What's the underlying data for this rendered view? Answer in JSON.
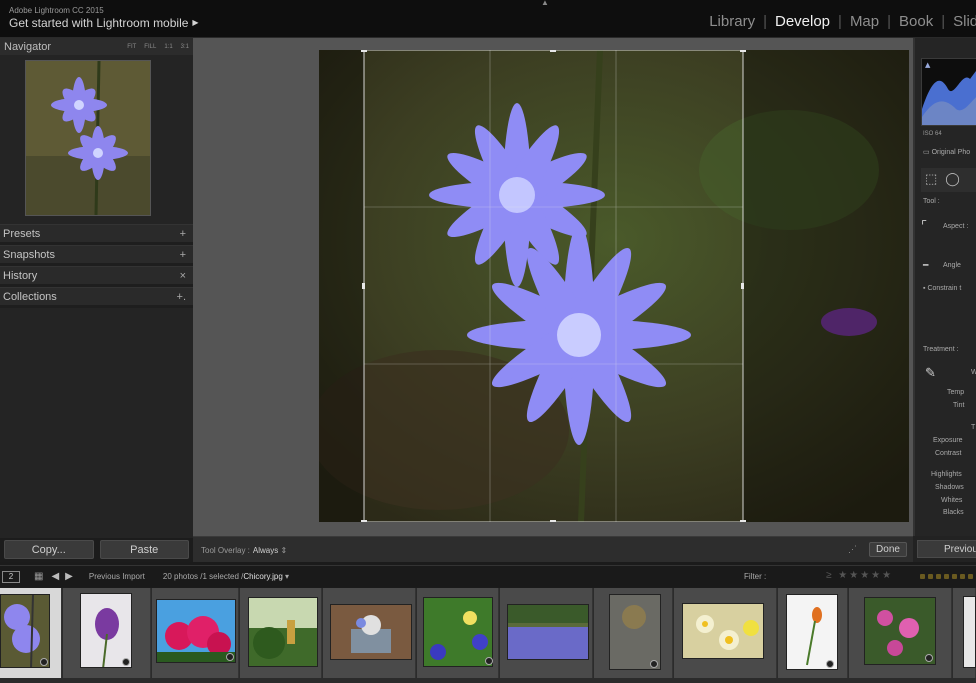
{
  "app": {
    "name": "Adobe Lightroom CC 2015",
    "promo": "Get started with Lightroom mobile",
    "modules": [
      "Library",
      "Develop",
      "Map",
      "Book",
      "Slides"
    ],
    "active_module": "Develop"
  },
  "navigator": {
    "title": "Navigator",
    "zoom_options": [
      "FIT",
      "FILL",
      "1:1",
      "3:1"
    ]
  },
  "left_panels": [
    {
      "label": "Presets",
      "symbol": "+"
    },
    {
      "label": "Snapshots",
      "symbol": "+"
    },
    {
      "label": "History",
      "symbol": "×"
    },
    {
      "label": "Collections",
      "symbol": "+."
    }
  ],
  "left_buttons": {
    "copy": "Copy...",
    "paste": "Paste"
  },
  "toolbar": {
    "overlay_label": "Tool Overlay :",
    "overlay_value": "Always",
    "done": "Done"
  },
  "right_panel": {
    "iso": "ISO 64",
    "original_photo": "Original Pho",
    "tool": "Tool :",
    "aspect": "Aspect :",
    "angle": "Angle",
    "constrain": "Constrain t",
    "treatment": "Treatment :",
    "wb_initial": "W",
    "temp": "Temp",
    "tint": "Tint",
    "tone_initial": "T",
    "exposure": "Exposure",
    "contrast": "Contrast",
    "highlights": "Highlights",
    "shadows": "Shadows",
    "whites": "Whites",
    "blacks": "Blacks",
    "previous": "Previous"
  },
  "filmstrip": {
    "monitor": "2",
    "source": "Previous Import",
    "count": "20 photos /1 selected /",
    "filename": "Chicory.jpg",
    "filter_label": "Filter :",
    "thumbnails": [
      "chicory",
      "purple-flower",
      "pink-flowers",
      "garden-person",
      "planter",
      "purple-flowers-bush",
      "lavender-field",
      "stone-statue",
      "daffodils",
      "tulip-white",
      "pink-phlox",
      "white-flower"
    ]
  }
}
